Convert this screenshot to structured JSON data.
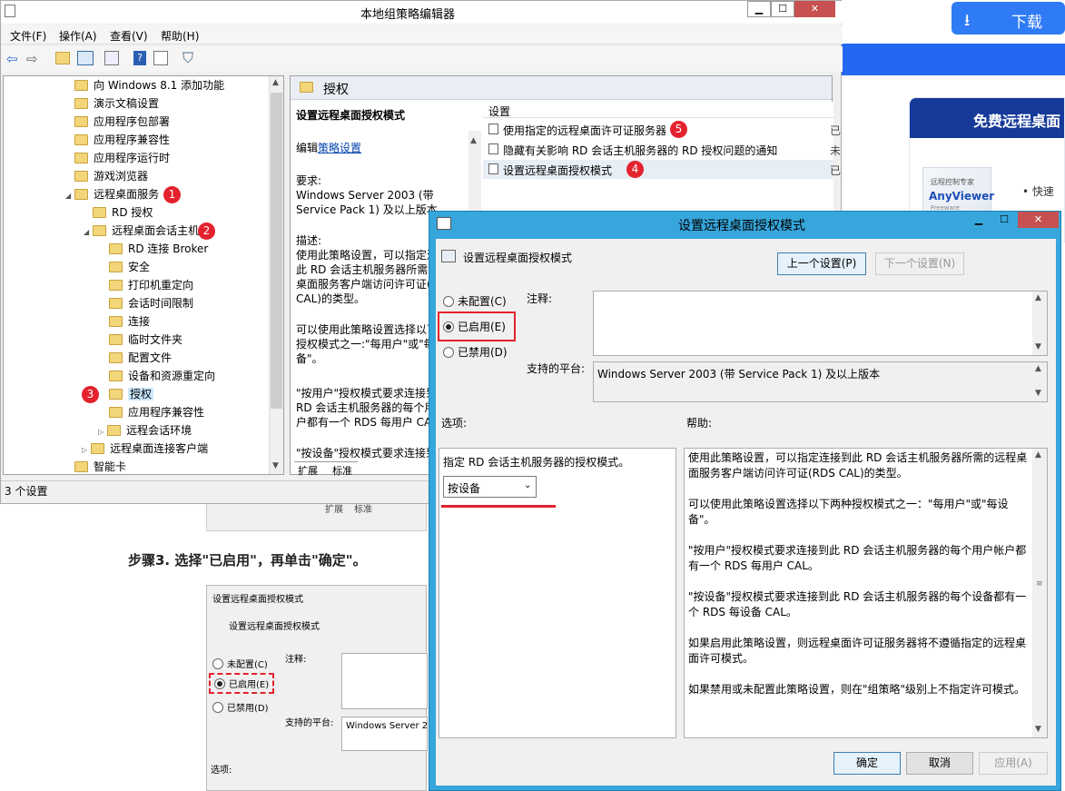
{
  "browser_page": {
    "download_label": "下载",
    "download_icon": "download-icon",
    "promo_title": "免费远程桌面",
    "product_name": "AnyViewer",
    "product_sub": "远程控制专家",
    "product_tag": "Freeware",
    "bullet": "快速",
    "step3_text": "步骤3. 选择\"已启用\"，再单击\"确定\"。",
    "mini_tab1": "扩展",
    "mini_tab2": "标准",
    "mini_dialog": {
      "title": "设置远程桌面授权模式",
      "setting": "设置远程桌面授权模式",
      "not_configured": "未配置(C)",
      "enabled": "已启用(E)",
      "disabled": "已禁用(D)",
      "comment": "注释:",
      "platform": "支持的平台:",
      "platform_value": "Windows Server 2",
      "options": "选项:"
    }
  },
  "editor": {
    "title": "本地组策略编辑器",
    "menu": [
      "文件(F)",
      "操作(A)",
      "查看(V)",
      "帮助(H)"
    ],
    "tree": [
      {
        "label": "向 Windows 8.1 添加功能"
      },
      {
        "label": "演示文稿设置"
      },
      {
        "label": "应用程序包部署"
      },
      {
        "label": "应用程序兼容性"
      },
      {
        "label": "应用程序运行时"
      },
      {
        "label": "游戏浏览器"
      },
      {
        "label": "远程桌面服务",
        "badge": "1"
      },
      {
        "label": "RD 授权"
      },
      {
        "label": "远程桌面会话主机",
        "badge": "2"
      },
      {
        "label": "RD 连接 Broker"
      },
      {
        "label": "安全"
      },
      {
        "label": "打印机重定向"
      },
      {
        "label": "会话时间限制"
      },
      {
        "label": "连接"
      },
      {
        "label": "临时文件夹"
      },
      {
        "label": "配置文件"
      },
      {
        "label": "设备和资源重定向"
      },
      {
        "label": "授权",
        "badge": "3"
      },
      {
        "label": "应用程序兼容性"
      },
      {
        "label": "远程会话环境"
      },
      {
        "label": "远程桌面连接客户端"
      },
      {
        "label": "智能卡"
      }
    ],
    "right_header": "授权",
    "desc_title": "设置远程桌面授权模式",
    "desc_edit_prefix": "编辑",
    "desc_edit_link": "策略设置",
    "desc_req_label": "要求:",
    "desc_req_1": "Windows Server 2003 (带",
    "desc_req_2": "Service Pack 1) 及以上版本",
    "desc_label": "描述:",
    "desc_1": "使用此策略设置，可以指定连",
    "desc_2": "此 RD 会话主机服务器所需的",
    "desc_3": "桌面服务客户端访问许可证(R",
    "desc_4": "CAL)的类型。",
    "desc_5": "可以使用此策略设置选择以下",
    "desc_6": "授权模式之一:\"每用户\"或\"每",
    "desc_7": "备\"。",
    "desc_8": "\"按用户\"授权模式要求连接到",
    "desc_9": "RD 会话主机服务器的每个用",
    "desc_10": "户都有一个 RDS 每用户 CAL",
    "desc_11": "\"按设备\"授权模式要求连接到",
    "list_header": "设置",
    "settings": [
      {
        "label": "使用指定的远程桌面许可证服务器",
        "badge": "5",
        "state": "已"
      },
      {
        "label": "隐藏有关影响 RD 会话主机服务器的 RD 授权问题的通知",
        "state": "未"
      },
      {
        "label": "设置远程桌面授权模式",
        "badge": "4",
        "state": "已"
      }
    ],
    "tab_extended": "扩展",
    "tab_standard": "标准",
    "status": "3 个设置"
  },
  "dialog": {
    "title": "设置远程桌面授权模式",
    "setting_name": "设置远程桌面授权模式",
    "prev_button": "上一个设置(P)",
    "next_button": "下一个设置(N)",
    "not_configured": "未配置(C)",
    "enabled": "已启用(E)",
    "disabled": "已禁用(D)",
    "comment_label": "注释:",
    "platform_label": "支持的平台:",
    "platform_value": "Windows Server 2003 (带 Service Pack 1) 及以上版本",
    "options_label": "选项:",
    "help_label": "帮助:",
    "option_desc": "指定 RD 会话主机服务器的授权模式。",
    "option_value": "按设备",
    "help": [
      "使用此策略设置，可以指定连接到此 RD 会话主机服务器所需的远程桌面服务客户端访问许可证(RDS CAL)的类型。",
      "可以使用此策略设置选择以下两种授权模式之一：\"每用户\"或\"每设备\"。",
      "\"按用户\"授权模式要求连接到此 RD 会话主机服务器的每个用户帐户都有一个 RDS 每用户 CAL。",
      "\"按设备\"授权模式要求连接到此 RD 会话主机服务器的每个设备都有一个 RDS 每设备 CAL。",
      "如果启用此策略设置，则远程桌面许可证服务器将不遵循指定的远程桌面许可模式。",
      "如果禁用或未配置此策略设置，则在\"组策略\"级别上不指定许可模式。"
    ],
    "ok_button": "确定",
    "cancel_button": "取消",
    "apply_button": "应用(A)"
  }
}
